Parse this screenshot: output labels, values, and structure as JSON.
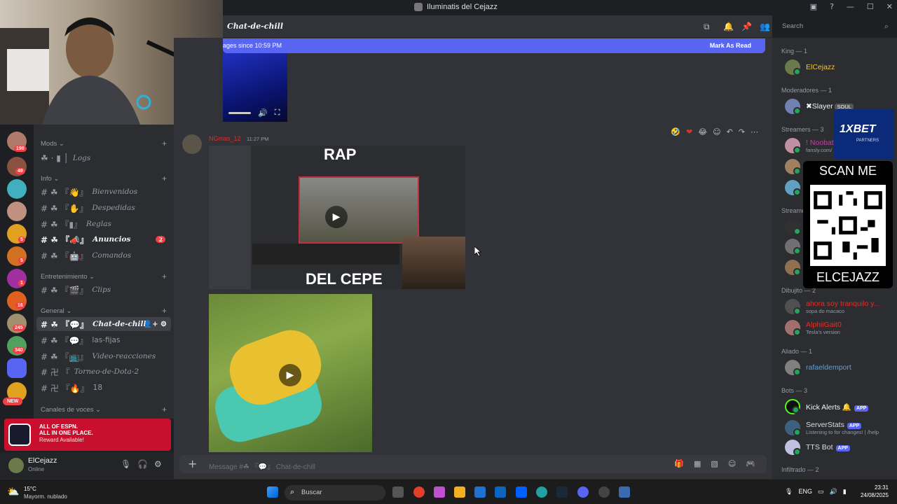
{
  "window": {
    "title": "Iluminatis del Cejazz"
  },
  "header": {
    "channel": "Chat-de-chill"
  },
  "search": {
    "placeholder": "Search"
  },
  "newbar": {
    "text": "ages since 10:59 PM",
    "action": "Mark As Read"
  },
  "rail": {
    "badges": [
      "198",
      "49",
      "",
      "",
      "5",
      "5",
      "1",
      "16",
      "245",
      "340"
    ],
    "new_label": "NEW"
  },
  "channels": {
    "logs_item": "Logs",
    "categories": [
      "Mods",
      "Info",
      "Entretenimiento",
      "General",
      "Canales de voces"
    ],
    "items": [
      {
        "label": "Bienvenidos",
        "cat": 1
      },
      {
        "label": "Despedidas",
        "cat": 1
      },
      {
        "label": "Reglas",
        "cat": 1
      },
      {
        "label": "Anuncios",
        "cat": 1,
        "count": "2"
      },
      {
        "label": "Comandos",
        "cat": 1
      },
      {
        "label": "Clips",
        "cat": 2
      },
      {
        "label": "Chat-de-chill",
        "cat": 3,
        "active": true
      },
      {
        "label": "las-fijas",
        "cat": 3
      },
      {
        "label": "Video-reacciones",
        "cat": 3
      },
      {
        "label": "Torneo-de-Dota-2",
        "cat": 3
      },
      {
        "label": "18",
        "cat": 3
      }
    ]
  },
  "promo": {
    "line1": "ALL OF ESPN.",
    "line2": "ALL IN ONE PLACE.",
    "line3": "Reward Available!"
  },
  "user": {
    "name": "ElCejazz",
    "status": "Online"
  },
  "message": {
    "author": "NGmas_12",
    "time": "11:27 PM",
    "img_top": "RAP",
    "img_bottom": "DEL CEPE"
  },
  "composer": {
    "placeholder": "Message #☘ 『💬』 Chat-de-chill"
  },
  "members": {
    "groups": [
      {
        "title": "King — 1",
        "members": [
          {
            "name": "ElCejazz",
            "color": "#f0c040"
          }
        ]
      },
      {
        "title": "Moderadores — 1",
        "members": [
          {
            "name": "✖Slayer",
            "color": "#f2f3f5",
            "tag": "SOUL"
          }
        ]
      },
      {
        "title": "Streamers — 3",
        "members": [
          {
            "name": "! Noobat",
            "color": "#c040a0",
            "sub": "fansly.com/"
          }
        ]
      },
      {
        "title": "Dibujito — 2",
        "members": [
          {
            "name": "ahora soy tranquilo y...",
            "color": "#e0302a",
            "sub": "sopa do macaco"
          },
          {
            "name": "AlphiiGait0",
            "color": "#e0302a",
            "sub": "Tesla's version"
          }
        ]
      },
      {
        "title": "Aliado — 1",
        "members": [
          {
            "name": "rafaeldemport",
            "color": "#5aa0e0"
          }
        ]
      },
      {
        "title": "Bots — 3",
        "members": [
          {
            "name": "Kick Alerts 🔔",
            "color": "#f2f3f5",
            "app": "APP"
          },
          {
            "name": "ServerStats",
            "color": "#dbdee1",
            "app": "APP",
            "sub": "Listening to for changes! | /help"
          },
          {
            "name": "TTS Bot",
            "color": "#dbdee1",
            "app": "APP"
          }
        ]
      },
      {
        "title": "Infiltrado — 2",
        "members": []
      }
    ],
    "partial_title": "Streame"
  },
  "ads": {
    "bet_logo": "1XBET",
    "bet_sub": "PARTNERS",
    "scan": "SCAN ME",
    "handle": "ELCEJAZZ"
  },
  "taskbar": {
    "weather_temp": "15°C",
    "weather_desc": "Mayorm. nublado",
    "search": "Buscar",
    "lang": "ENG",
    "time": "23:31",
    "date": "24/08/2025"
  }
}
